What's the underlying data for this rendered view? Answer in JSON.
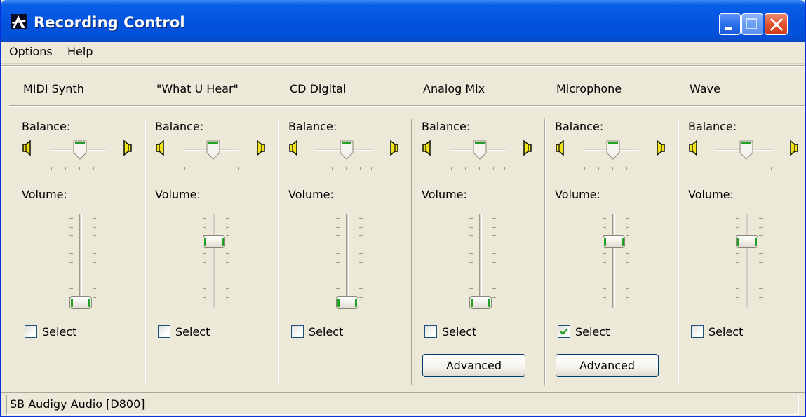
{
  "window": {
    "title": "Recording Control"
  },
  "menu": [
    "Options",
    "Help"
  ],
  "labels": {
    "balance": "Balance:",
    "volume": "Volume:",
    "select": "Select",
    "advanced": "Advanced"
  },
  "channels": [
    {
      "name": "MIDI Synth",
      "volume": 0.0,
      "selected": false,
      "advanced": false
    },
    {
      "name": "\"What U Hear\"",
      "volume": 0.7,
      "selected": false,
      "advanced": false
    },
    {
      "name": "CD Digital",
      "volume": 0.0,
      "selected": false,
      "advanced": false
    },
    {
      "name": "Analog Mix",
      "volume": 0.0,
      "selected": false,
      "advanced": true
    },
    {
      "name": "Microphone",
      "volume": 0.7,
      "selected": true,
      "advanced": true
    },
    {
      "name": "Wave",
      "volume": 0.7,
      "selected": false,
      "advanced": false
    }
  ],
  "status": {
    "text": "SB Audigy Audio [D800]"
  },
  "colors": {
    "titlebar": "#0454e0",
    "face": "#ece9d8",
    "checkmark": "#21a121"
  }
}
